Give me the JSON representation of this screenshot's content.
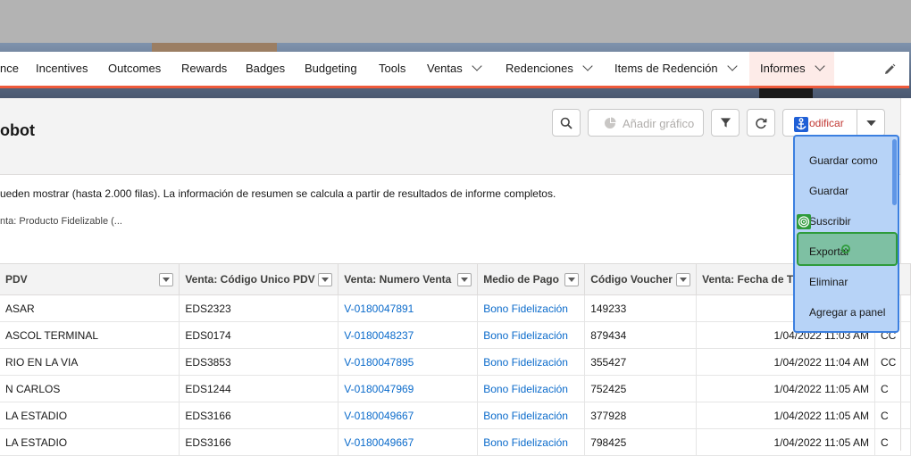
{
  "nav": {
    "items": [
      {
        "label": "nce",
        "has_chevron": false
      },
      {
        "label": "Incentives",
        "has_chevron": false
      },
      {
        "label": "Outcomes",
        "has_chevron": false
      },
      {
        "label": "Rewards",
        "has_chevron": false
      },
      {
        "label": "Badges",
        "has_chevron": false
      },
      {
        "label": "Budgeting",
        "has_chevron": false
      },
      {
        "label": "Tools",
        "has_chevron": false
      },
      {
        "label": "Ventas",
        "has_chevron": true
      },
      {
        "label": "Redenciones",
        "has_chevron": true
      },
      {
        "label": "Items de Redención",
        "has_chevron": true
      },
      {
        "label": "Informes",
        "has_chevron": true,
        "active": true
      }
    ],
    "edit_icon": "pencil-icon",
    "accent_color": "#ef5a3b"
  },
  "report": {
    "title": "obot",
    "toolbar": {
      "search_icon": "search-icon",
      "add_chart_label": "Añadir gráfico",
      "filter_icon": "filter-icon",
      "refresh_icon": "refresh-icon",
      "modify_label": "odificar",
      "dropdown_icon": "chevron-down-icon"
    },
    "info_text": "ueden mostrar (hasta 2.000 filas). La información de resumen se calcula a partir de resultados de informe completos.",
    "filter_text": "nta: Producto Fidelizable (..."
  },
  "table": {
    "columns": [
      "PDV",
      "Venta: Código Unico PDV",
      "Venta: Numero Venta",
      "Medio de Pago",
      "Código Voucher",
      "Venta: Fecha de Tr"
    ],
    "rows": [
      [
        "ASAR",
        "EDS2323",
        "V-0180047891",
        "Bono Fidelización",
        "149233",
        "1/04/2",
        ""
      ],
      [
        "ASCOL TERMINAL",
        "EDS0174",
        "V-0180048237",
        "Bono Fidelización",
        "879434",
        "1/04/2022 11:03 AM",
        "CC"
      ],
      [
        "RIO EN LA VIA",
        "EDS3853",
        "V-0180047895",
        "Bono Fidelización",
        "355427",
        "1/04/2022 11:04 AM",
        "CC"
      ],
      [
        "N CARLOS",
        "EDS1244",
        "V-0180047969",
        "Bono Fidelización",
        "752425",
        "1/04/2022 11:05 AM",
        "C"
      ],
      [
        "LA ESTADIO",
        "EDS3166",
        "V-0180049667",
        "Bono Fidelización",
        "377928",
        "1/04/2022 11:05 AM",
        "C"
      ],
      [
        "LA ESTADIO",
        "EDS3166",
        "V-0180049667",
        "Bono Fidelización",
        "798425",
        "1/04/2022 11:05 AM",
        "C"
      ]
    ]
  },
  "menu": {
    "items": [
      "Guardar como",
      "Guardar",
      "Suscribir",
      "Exportar",
      "Eliminar",
      "Agregar a panel"
    ],
    "selected": "Exportar",
    "highlight_color": "#2e9b3b"
  }
}
